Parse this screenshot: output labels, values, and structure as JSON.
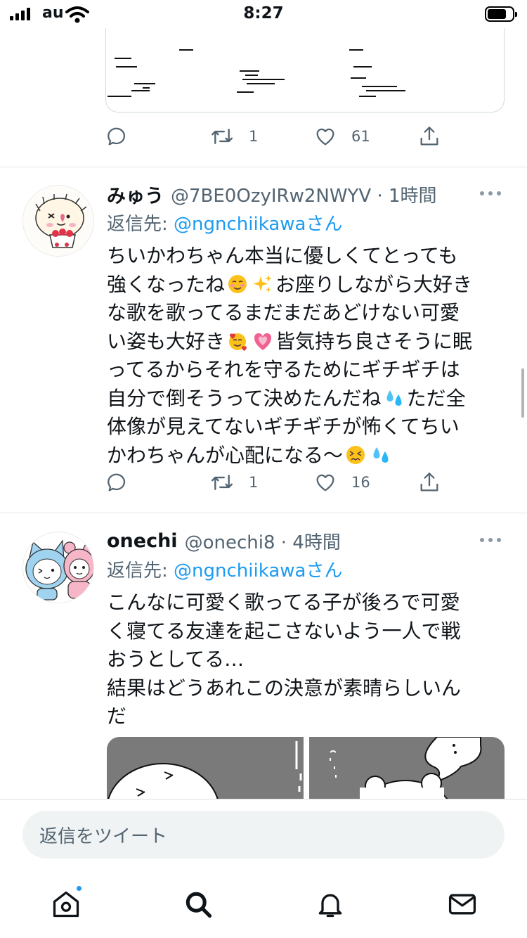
{
  "status_bar": {
    "carrier": "au",
    "time": "8:27"
  },
  "previous_tweet": {
    "stats": {
      "retweets": "1",
      "likes": "61"
    }
  },
  "tweets": [
    {
      "display_name": "みゅう",
      "handle_time": "@7BE0OzyIRw2NWYV · 1時間",
      "reply_prefix": "返信先: ",
      "reply_to": "@ngnchiikawaさん",
      "body_lines": [
        "ちいかわちゃん本当に優しくてとっても",
        "強くなったね",
        "お座りしながら大好き",
        "な歌を歌ってるまだまだあどけない可愛",
        "い姿も大好き",
        "皆気持ち良さそうに眠",
        "ってるからそれを守るためにギチギチは",
        "自分で倒そうって決めたんだね",
        "ただ全",
        "体像が見えてないギチギチが怖くてちい",
        "かわちゃんが心配になる〜"
      ],
      "stats": {
        "retweets": "1",
        "likes": "16"
      }
    },
    {
      "display_name": "onechi",
      "handle_time": "@onechi8 · 4時間",
      "reply_prefix": "返信先: ",
      "reply_to": "@ngnchiikawaさん",
      "body_lines": [
        "こんなに可愛く歌ってる子が後ろで可愛",
        "く寝てる友達を起こさないよう一人で戦",
        "おうとしてる…",
        "結果はどうあれこの決意が素晴らしいん",
        "だ"
      ]
    }
  ],
  "reply_bar": {
    "placeholder": "返信をツイート"
  },
  "tab_bar": {
    "items": [
      "home-icon",
      "search-icon",
      "notifications-icon",
      "messages-icon"
    ],
    "home_has_unread": true
  },
  "colors": {
    "accent": "#1d9bf0",
    "muted": "#536471",
    "text": "#0f1419"
  }
}
